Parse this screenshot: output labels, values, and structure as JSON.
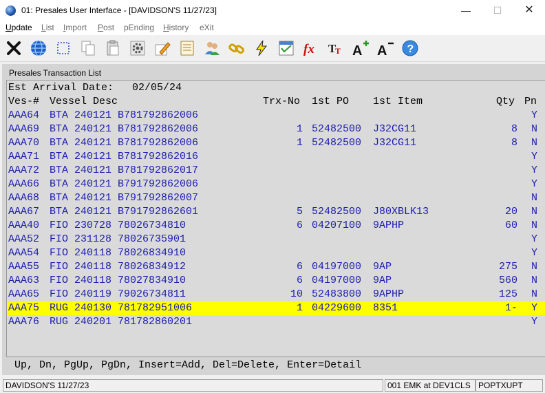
{
  "window": {
    "title": "01: Presales User Interface - [DAVIDSON'S 11/27/23]",
    "minimize": "—",
    "maximize": "☐",
    "close": "✕"
  },
  "menu": [
    {
      "label": "Update",
      "underline": "U",
      "rest": "pdate",
      "active": true
    },
    {
      "label": "List",
      "underline": "L",
      "rest": "ist",
      "active": false
    },
    {
      "label": "Import",
      "underline": "I",
      "rest": "mport",
      "active": false
    },
    {
      "label": "Post",
      "underline": "P",
      "rest": "ost",
      "active": false
    },
    {
      "label": "pEnding",
      "underline": "",
      "rest": "pEnding",
      "active": false
    },
    {
      "label": "History",
      "underline": "H",
      "rest": "istory",
      "active": false
    },
    {
      "label": "eXit",
      "underline": "",
      "rest": "eXit",
      "active": false
    }
  ],
  "toolbar": [
    "close-x-icon",
    "globe-icon",
    "select-icon",
    "copy-icon",
    "paste-icon",
    "settings-gear-icon",
    "edit-pencil-icon",
    "notes-icon",
    "users-icon",
    "link-chain-icon",
    "lightning-icon",
    "calculator-icon",
    "function-fx-icon",
    "font-tt-icon",
    "font-increase-icon",
    "font-decrease-icon",
    "help-icon"
  ],
  "panel": {
    "title": "Presales Transaction List",
    "arrival_label": "Est Arrival Date:",
    "arrival_date": "02/05/24",
    "columns": {
      "ves": "Ves-#",
      "desc": "Vessel Desc",
      "trx": "Trx-No",
      "po": "1st PO",
      "item": "1st Item",
      "qty": "Qty",
      "pn": "Pn"
    },
    "rows": [
      {
        "ves": "AAA64",
        "desc": "BTA 240121 B781792862006",
        "trx": "",
        "po": "",
        "item": "",
        "qty": "",
        "pn": "Y",
        "selected": false
      },
      {
        "ves": "AAA69",
        "desc": "BTA 240121 B781792862006",
        "trx": "1",
        "po": "52482500",
        "item": "J32CG11",
        "qty": "8",
        "pn": "N",
        "selected": false
      },
      {
        "ves": "AAA70",
        "desc": "BTA 240121 B781792862006",
        "trx": "1",
        "po": "52482500",
        "item": "J32CG11",
        "qty": "8",
        "pn": "N",
        "selected": false
      },
      {
        "ves": "AAA71",
        "desc": "BTA 240121 B781792862016",
        "trx": "",
        "po": "",
        "item": "",
        "qty": "",
        "pn": "Y",
        "selected": false
      },
      {
        "ves": "AAA72",
        "desc": "BTA 240121 B781792862017",
        "trx": "",
        "po": "",
        "item": "",
        "qty": "",
        "pn": "Y",
        "selected": false
      },
      {
        "ves": "AAA66",
        "desc": "BTA 240121 B791792862006",
        "trx": "",
        "po": "",
        "item": "",
        "qty": "",
        "pn": "Y",
        "selected": false
      },
      {
        "ves": "AAA68",
        "desc": "BTA 240121 B791792862007",
        "trx": "",
        "po": "",
        "item": "",
        "qty": "",
        "pn": "N",
        "selected": false
      },
      {
        "ves": "AAA67",
        "desc": "BTA 240121 B791792862601",
        "trx": "5",
        "po": "52482500",
        "item": "J80XBLK13",
        "qty": "20",
        "pn": "N",
        "selected": false
      },
      {
        "ves": "AAA40",
        "desc": "FIO 230728 78026734810",
        "trx": "6",
        "po": "04207100",
        "item": "9APHP",
        "qty": "60",
        "pn": "N",
        "selected": false
      },
      {
        "ves": "AAA52",
        "desc": "FIO 231128 78026735901",
        "trx": "",
        "po": "",
        "item": "",
        "qty": "",
        "pn": "Y",
        "selected": false
      },
      {
        "ves": "AAA54",
        "desc": "FIO 240118 78026834910",
        "trx": "",
        "po": "",
        "item": "",
        "qty": "",
        "pn": "Y",
        "selected": false
      },
      {
        "ves": "AAA55",
        "desc": "FIO 240118 78026834912",
        "trx": "6",
        "po": "04197000",
        "item": "9AP",
        "qty": "275",
        "pn": "N",
        "selected": false
      },
      {
        "ves": "AAA63",
        "desc": "FIO 240118 78027834910",
        "trx": "6",
        "po": "04197000",
        "item": "9AP",
        "qty": "560",
        "pn": "N",
        "selected": false
      },
      {
        "ves": "AAA65",
        "desc": "FIO 240119 79026734811",
        "trx": "10",
        "po": "52483800",
        "item": "9APHP",
        "qty": "125",
        "pn": "N",
        "selected": false
      },
      {
        "ves": "AAA75",
        "desc": "RUG 240130 781782951006",
        "trx": "1",
        "po": "04229600",
        "item": "8351",
        "qty": "1-",
        "pn": "Y",
        "selected": true
      },
      {
        "ves": "AAA76",
        "desc": "RUG 240201 781782860201",
        "trx": "",
        "po": "",
        "item": "",
        "qty": "",
        "pn": "Y",
        "selected": false
      }
    ],
    "footer_keys": "Up, Dn, PgUp, PgDn, Insert=Add, Del=Delete, Enter=Detail"
  },
  "status": {
    "company": "DAVIDSON'S 11/27/23",
    "session": "001 EMK at DEV1CLS",
    "program": "POPTXUPT"
  }
}
